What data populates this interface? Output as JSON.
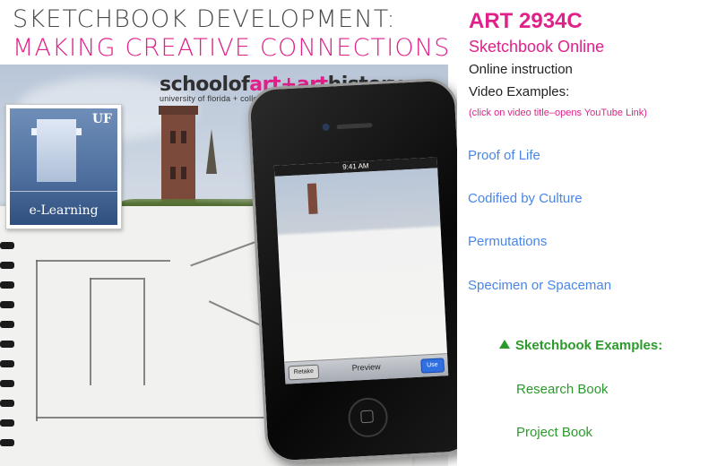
{
  "hero": {
    "title_line1": "SKETCHBOOK DEVELOPMENT:",
    "title_line2": "MAKING CREATIVE CONNECTIONS",
    "school_logo": {
      "part1": "schoolof",
      "part2": "art+art",
      "part3": "history",
      "subtitle": "university of florida + college of fine arts"
    },
    "uf_badge": {
      "mark": "UF",
      "label": "e-Learning"
    },
    "phone": {
      "status_time": "9:41 AM",
      "retake_label": "Retake",
      "preview_label": "Preview",
      "use_label": "Use"
    }
  },
  "info": {
    "course_code": "ART 2934C",
    "course_name": "Sketchbook Online",
    "line1": "Online instruction",
    "line2": "Video Examples:",
    "note": "(click on video title–opens YouTube Link)",
    "videos": [
      "Proof of Life",
      "Codified by Culture",
      "Permutations",
      "Specimen or Spaceman"
    ],
    "examples_header": "Sketchbook Examples:",
    "examples": [
      "Research Book",
      "Project Book"
    ]
  },
  "colors": {
    "pink": "#e0218a",
    "blue_link": "#4a86e8",
    "green": "#2b9a2b"
  }
}
